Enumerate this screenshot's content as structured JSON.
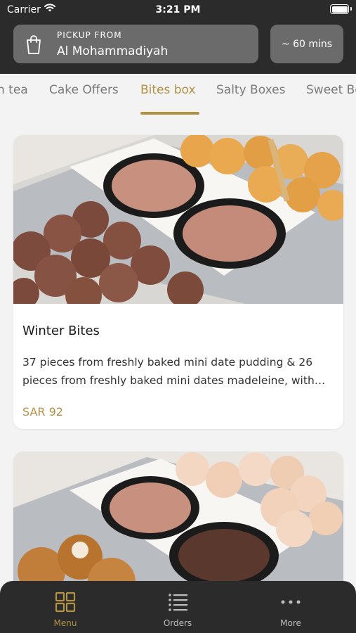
{
  "status_bar": {
    "carrier": "Carrier",
    "time": "3:21 PM"
  },
  "header": {
    "pickup_label": "PICKUP FROM",
    "pickup_location": "Al Mohammadiyah",
    "estimated_time": "~ 60 mins"
  },
  "category_tabs": [
    {
      "label": "n tea"
    },
    {
      "label": "Cake Offers"
    },
    {
      "label": "Bites box",
      "active": true
    },
    {
      "label": "Salty Boxes"
    },
    {
      "label": "Sweet Bo"
    }
  ],
  "products": [
    {
      "title": "Winter Bites",
      "description_lines": [
        "37 pieces from freshly baked mini date pudding & 26",
        "pieces from freshly baked mini dates madeleine, with…"
      ],
      "price": "SAR 92"
    }
  ],
  "tab_bar": {
    "items": [
      {
        "label": "Menu",
        "icon": "grid-icon",
        "active": true
      },
      {
        "label": "Orders",
        "icon": "list-icon"
      },
      {
        "label": "More",
        "icon": "more-dots-icon"
      }
    ]
  },
  "colors": {
    "accent": "#b39143",
    "header_bg": "#2b2b2b",
    "chip_bg": "#6b6b6b",
    "page_bg": "#f3f3f3"
  }
}
